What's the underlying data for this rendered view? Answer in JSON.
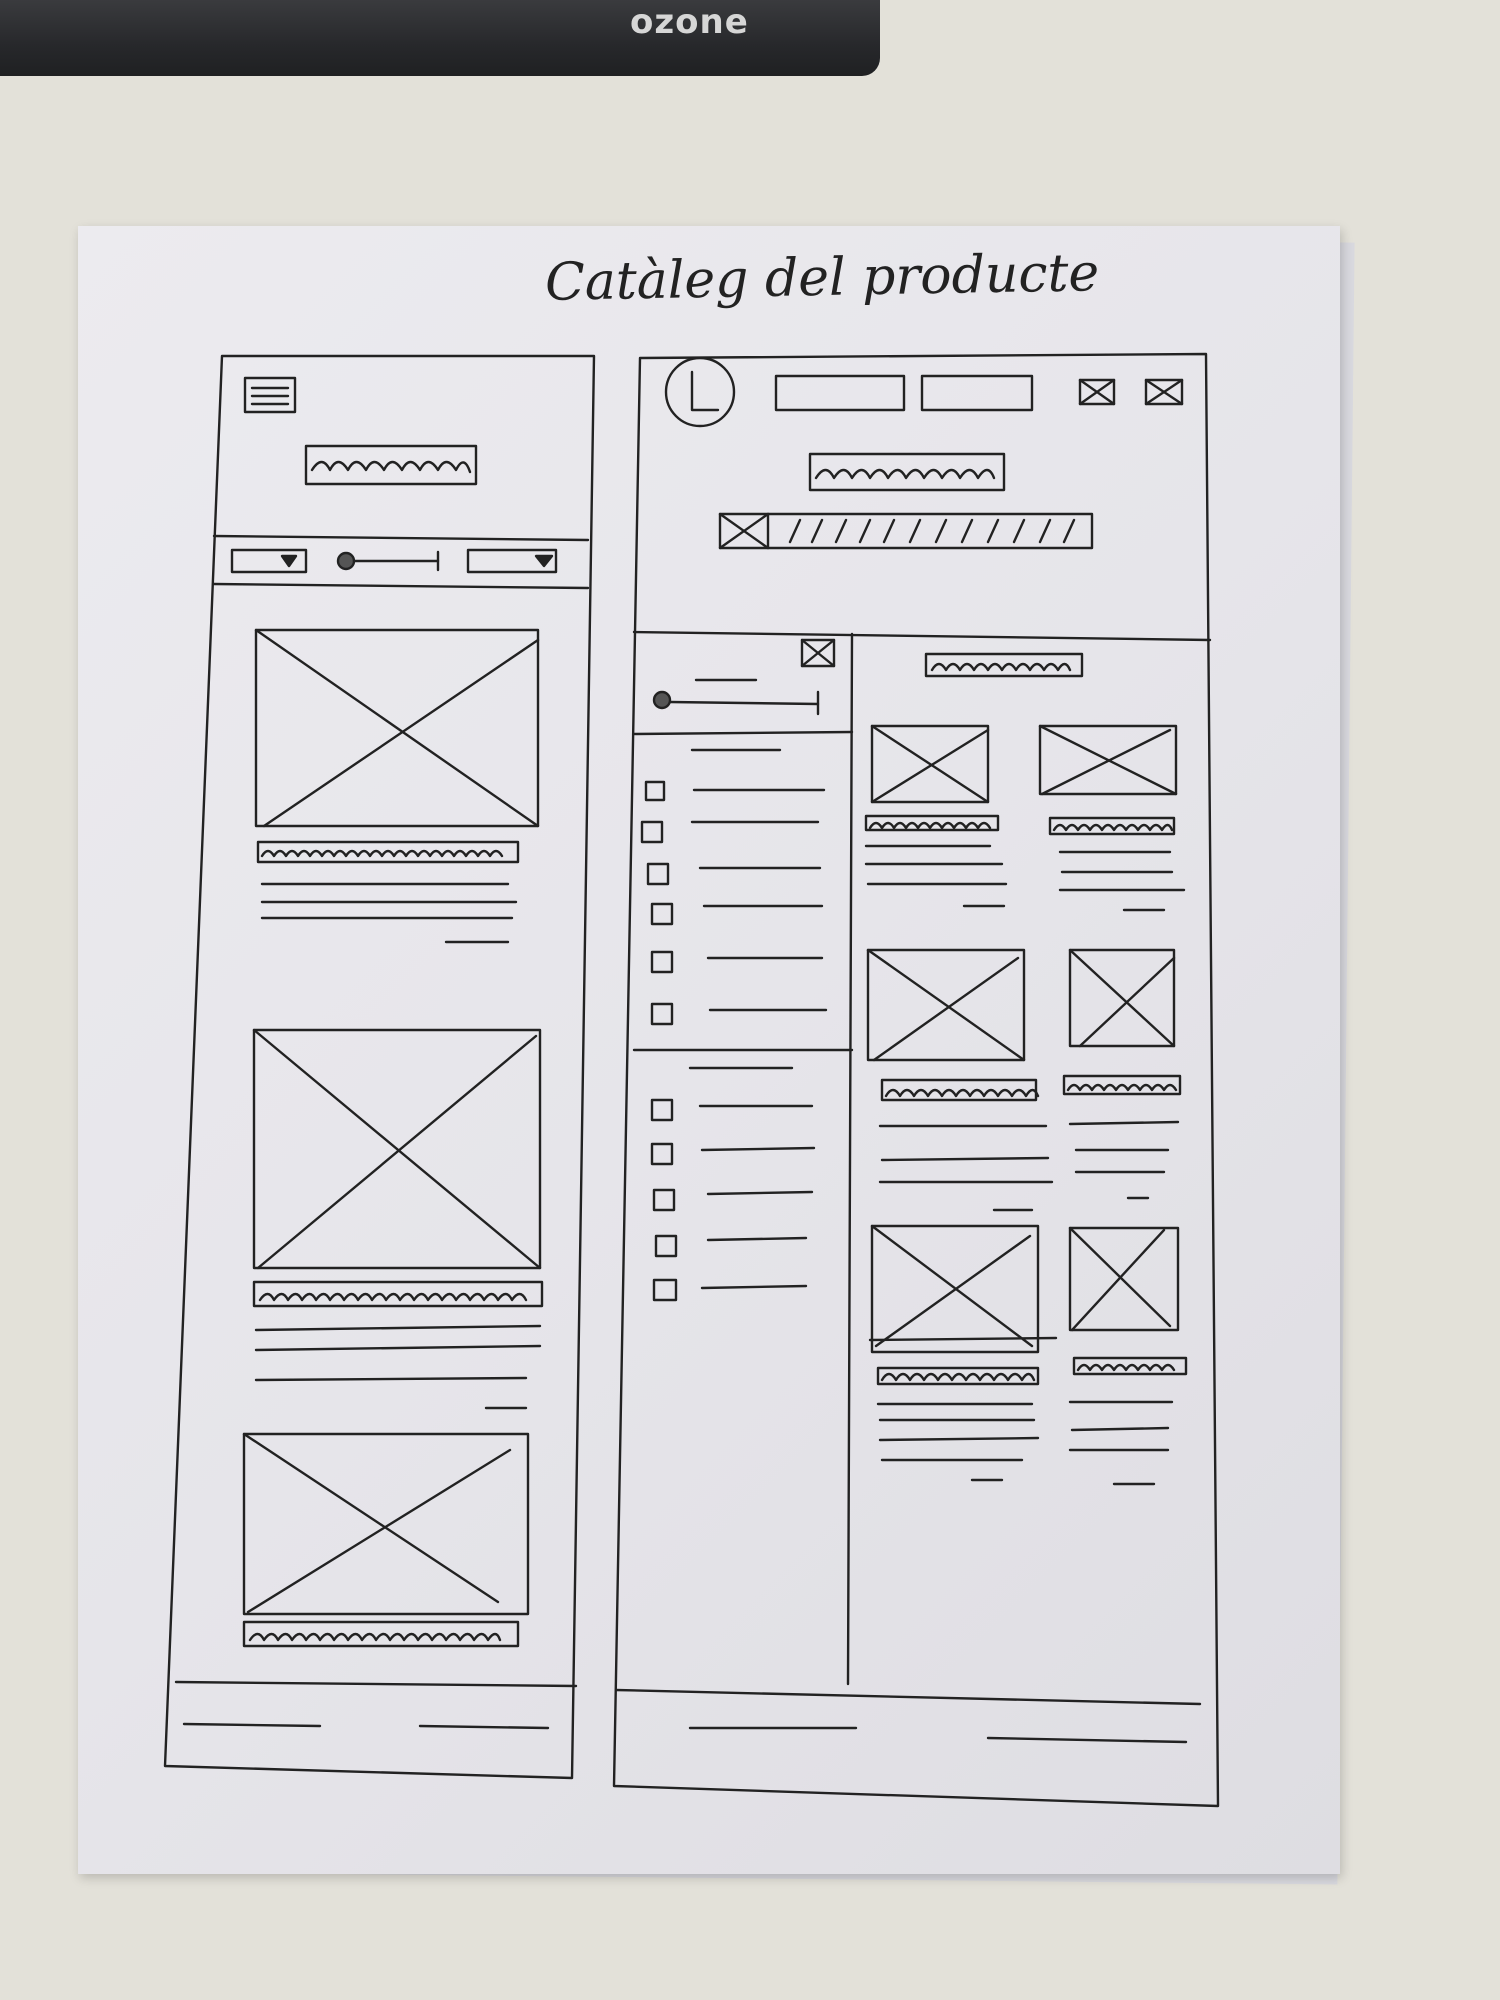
{
  "photo": {
    "keyboard_brand": "ozone",
    "sketch_title": "Catàleg del producte"
  },
  "colors": {
    "ink": "#222222",
    "paper": "#e8e7ec",
    "desk": "#e3e1d9"
  }
}
